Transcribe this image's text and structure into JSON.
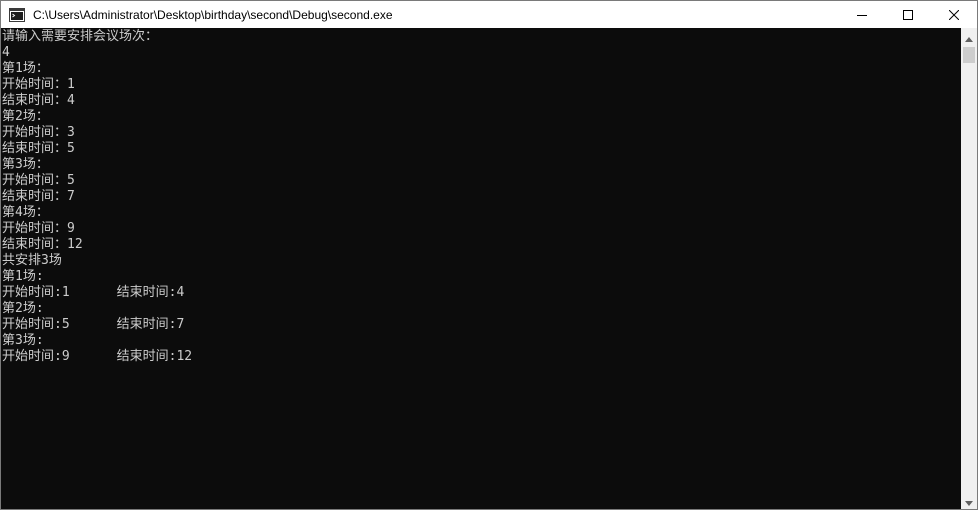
{
  "window": {
    "title": "C:\\Users\\Administrator\\Desktop\\birthday\\second\\Debug\\second.exe"
  },
  "icons": {
    "app": "console-app-icon",
    "minimize": "minimize-icon",
    "maximize": "maximize-icon",
    "close": "close-icon",
    "scroll_up": "scroll-up-arrow-icon",
    "scroll_down": "scroll-down-arrow-icon"
  },
  "colors": {
    "console_background": "#0c0c0c",
    "console_text": "#cccccc",
    "titlebar": "#ffffff"
  },
  "console": {
    "lines": [
      "请输入需要安排会议场次：",
      "4",
      "第1场：",
      "开始时间：1",
      "结束时间：4",
      "第2场：",
      "开始时间：3",
      "结束时间：5",
      "第3场：",
      "开始时间：5",
      "结束时间：7",
      "第4场：",
      "开始时间：9",
      "结束时间：12",
      "共安排3场",
      "第1场:",
      "开始时间:1      结束时间:4",
      "第2场:",
      "开始时间:5      结束时间:7",
      "第3场:",
      "开始时间:9      结束时间:12"
    ]
  }
}
